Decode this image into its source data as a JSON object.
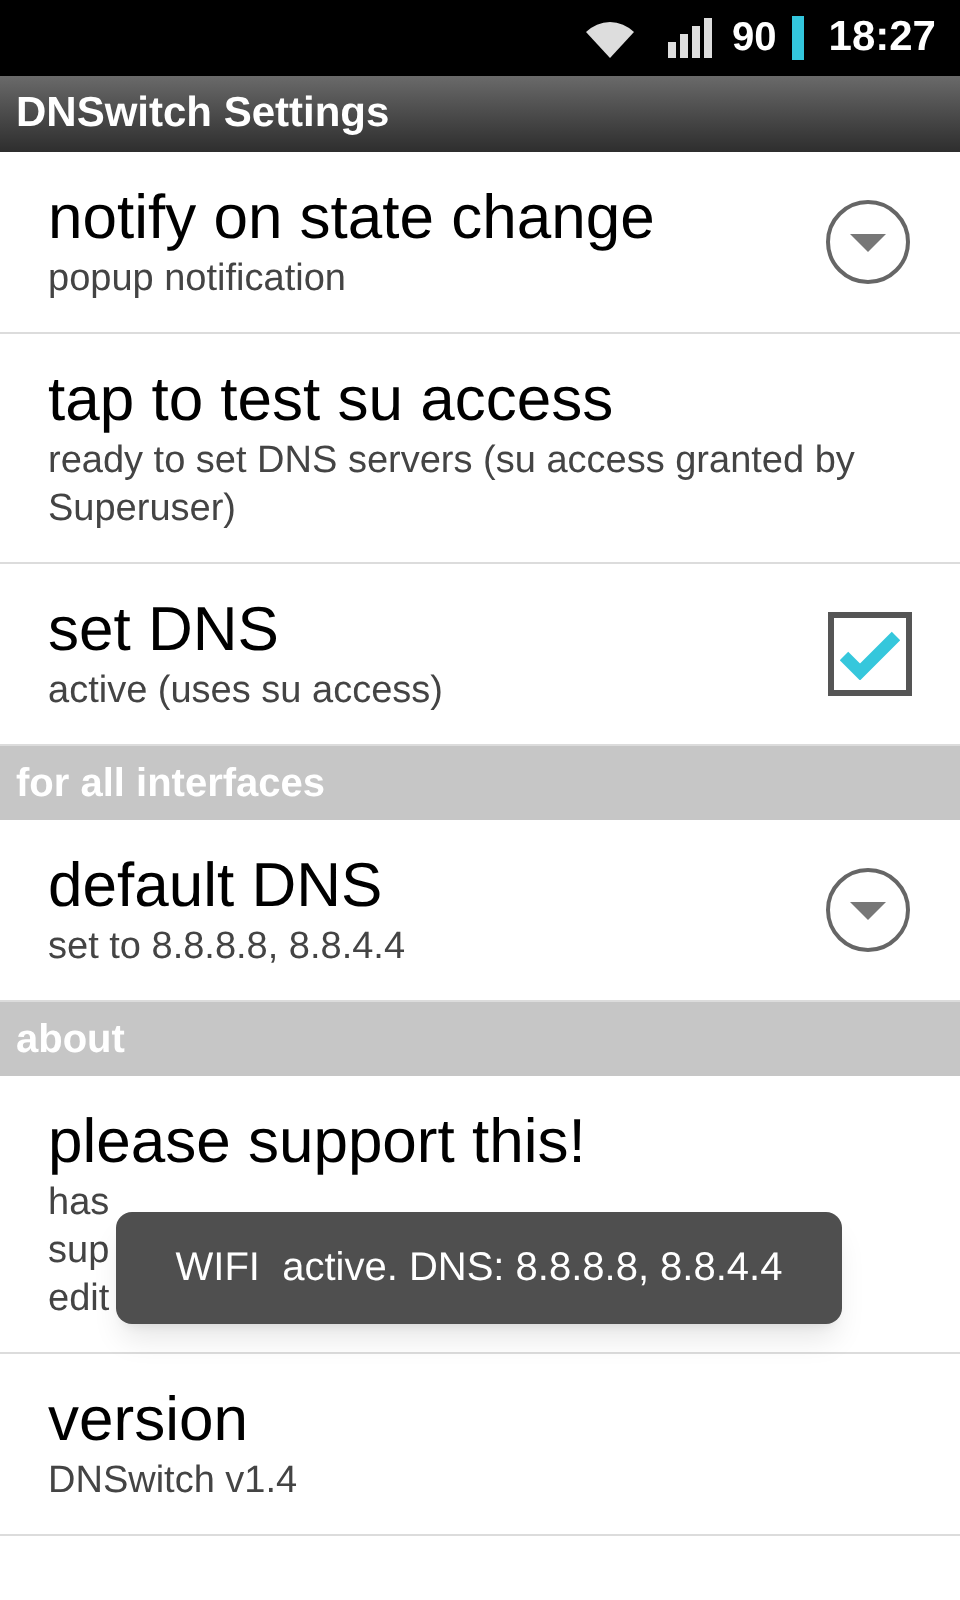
{
  "status_bar": {
    "battery": "90",
    "time": "18:27"
  },
  "window": {
    "title": "DNSwitch Settings"
  },
  "sections": [
    {
      "items": [
        {
          "kind": "dropdown",
          "title": "notify on state change",
          "summary": [
            "popup notification"
          ]
        },
        {
          "kind": "plain",
          "title": "tap to test su access",
          "summary": [
            "ready to set DNS servers (su access granted by",
            "Superuser)"
          ]
        },
        {
          "kind": "checkbox",
          "title": "set DNS",
          "summary": [
            "active (uses su access)"
          ],
          "checked": true
        }
      ]
    },
    {
      "header": "for all interfaces",
      "items": [
        {
          "kind": "dropdown",
          "title": "default DNS",
          "summary": [
            "set to 8.8.8.8, 8.8.4.4"
          ]
        }
      ]
    },
    {
      "header": "about",
      "items": [
        {
          "kind": "plain",
          "title": "please support this!",
          "summary": [
            "has",
            "sup",
            "edit"
          ],
          "toast": "WIFI  active. DNS: 8.8.8.8, 8.8.4.4"
        },
        {
          "kind": "plain",
          "title": "version",
          "summary": [
            "DNSwitch v1.4"
          ]
        }
      ]
    }
  ]
}
